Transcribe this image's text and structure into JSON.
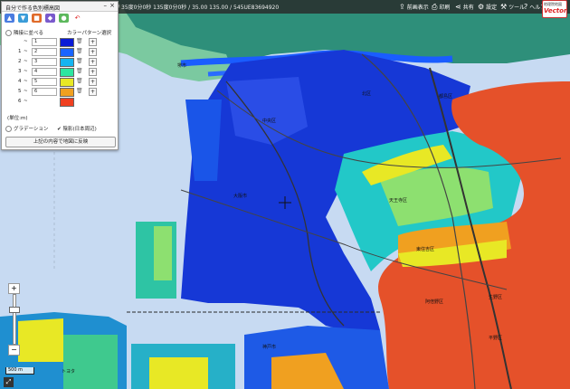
{
  "topbar": {
    "coords_text": "35度0分0秒 135度0分0秒 / 35.00 135.00 / 545UE83694920",
    "buttons": [
      {
        "label": "前画表示",
        "icon": "share-icon"
      },
      {
        "label": "印刷",
        "icon": "print-icon"
      },
      {
        "label": "共有",
        "icon": "share-icon"
      },
      {
        "label": "設定",
        "icon": "gear-icon"
      },
      {
        "label": "ツール",
        "icon": "tool-icon"
      },
      {
        "label": "ヘルプ",
        "icon": "help-icon"
      }
    ],
    "logo_line1": "地理院地図",
    "logo_line2": "Vector"
  },
  "panel": {
    "title": "自分で作る色別標高図",
    "mode_label": "隣接に並べる",
    "palette_label": "カラーパターン選択",
    "rows": [
      {
        "lo": "",
        "hi": "1",
        "color": "#0a1bd6"
      },
      {
        "lo": "1",
        "hi": "2",
        "color": "#1a64ff"
      },
      {
        "lo": "2",
        "hi": "3",
        "color": "#16b4f0"
      },
      {
        "lo": "3",
        "hi": "4",
        "color": "#2ee6a0"
      },
      {
        "lo": "4",
        "hi": "5",
        "color": "#e8e825"
      },
      {
        "lo": "5",
        "hi": "6",
        "color": "#f0a020"
      },
      {
        "lo": "6",
        "hi": "",
        "color": "#f04020"
      }
    ],
    "unit_label": "(単位:m)",
    "gradation_label": "グラデーション",
    "shading_label": "陰影(日本周辺)",
    "apply_label": "上記の内容で地図に反映"
  },
  "map": {
    "scale_label": "500 m",
    "place_labels": [
      "堺市",
      "大阪市",
      "中央区",
      "北区",
      "都島区",
      "神戸市",
      "東住吉区",
      "天王寺区",
      "生野区",
      "阿倍野区",
      "平野区",
      "トヨタ"
    ]
  }
}
